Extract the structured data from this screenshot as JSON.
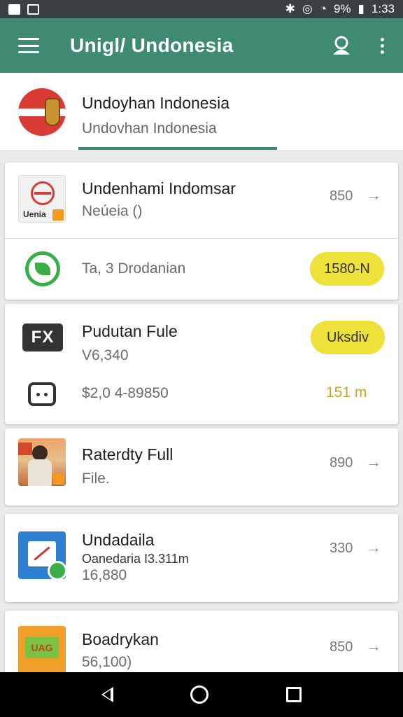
{
  "status_bar": {
    "battery": "9%",
    "time": "1:33",
    "left_icons": [
      "notification-icon",
      "image-icon"
    ],
    "right_icons": [
      "bluetooth-icon",
      "alarm-icon",
      "wifi-icon",
      "signal-icon",
      "battery-icon"
    ]
  },
  "app_bar": {
    "title": "Unigl/ Undonesia",
    "icons": [
      "menu-icon",
      "account-icon",
      "more-icon"
    ],
    "color": "#3f8a72"
  },
  "header": {
    "title": "Undoyhan Indonesia",
    "subtitle": "Undovhan Indonesia"
  },
  "cards": [
    {
      "rows": [
        {
          "title": "Undenhami Indomsar",
          "subtitle": "Neúeia ()",
          "value": "850",
          "thumb_caption": "Uenia"
        },
        {
          "title": "Ta, 3 Drodanian",
          "pill": "1580-N"
        }
      ]
    },
    {
      "rows": [
        {
          "title": "Pudutan Fule",
          "subtitle": "V6,340",
          "pill": "Uksdiv"
        },
        {
          "title": "$2,0 4-89850",
          "value": "151 m"
        }
      ]
    },
    {
      "rows": [
        {
          "title": "Raterdty Full",
          "subtitle": "File.",
          "value": "890"
        }
      ]
    },
    {
      "rows": [
        {
          "title": "Undadaila",
          "subtitle": "Oanedaria I3.311m",
          "subtitle2": "16,880",
          "value": "330"
        }
      ]
    },
    {
      "rows": [
        {
          "title": "Boadrykan",
          "subtitle": "56,100)",
          "value": "850",
          "thumb_caption": "UAG"
        }
      ]
    }
  ],
  "arrow_glyph": "→",
  "fx_label": "FX",
  "colors": {
    "accent": "#3f8a72",
    "pill": "#ede13a",
    "value_highlight": "#c8a51a"
  },
  "nav_bar": {
    "icons": [
      "back-icon",
      "home-icon",
      "recents-icon"
    ]
  }
}
